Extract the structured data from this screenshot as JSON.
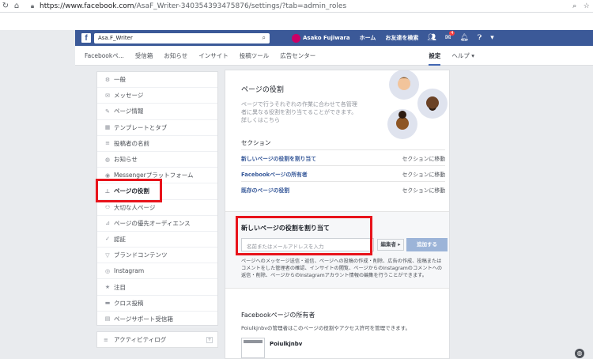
{
  "browser": {
    "url_host": "https://www.facebook.com",
    "url_path": "/AsaF_Writer-340354393475876/settings/?tab=admin_roles"
  },
  "fbbar": {
    "search_value": "Asa.F_Writer",
    "user_name": "Asako Fujiwara",
    "home": "ホーム",
    "find_friends": "お友達を検索",
    "notif_badge": "4"
  },
  "pagenav": {
    "tabs": [
      "Facebookペ...",
      "受信箱",
      "お知らせ",
      "インサイト",
      "投稿ツール",
      "広告センター"
    ],
    "settings": "設定",
    "help": "ヘルプ ▾"
  },
  "sidebar": {
    "items": [
      {
        "icon": "gear-icon",
        "glyph": "⚙",
        "label": "一般"
      },
      {
        "icon": "message-icon",
        "glyph": "✉",
        "label": "メッセージ"
      },
      {
        "icon": "pencil-icon",
        "glyph": "✎",
        "label": "ページ情報"
      },
      {
        "icon": "grid-icon",
        "glyph": "▦",
        "label": "テンプレートとタブ"
      },
      {
        "icon": "list-icon",
        "glyph": "≡",
        "label": "投稿者の名前"
      },
      {
        "icon": "globe-icon",
        "glyph": "◍",
        "label": "お知らせ"
      },
      {
        "icon": "messenger-icon",
        "glyph": "◉",
        "label": "Messengerプラットフォーム"
      },
      {
        "icon": "person-icon",
        "glyph": "⊥",
        "label": "ページの役割"
      },
      {
        "icon": "people-icon",
        "glyph": "⚇",
        "label": "大切な人ページ"
      },
      {
        "icon": "audience-icon",
        "glyph": "⊿",
        "label": "ページの優先オーディエンス"
      },
      {
        "icon": "wrench-icon",
        "glyph": "✓",
        "label": "認証"
      },
      {
        "icon": "branded-icon",
        "glyph": "▽",
        "label": "ブランドコンテンツ"
      },
      {
        "icon": "instagram-icon",
        "glyph": "◎",
        "label": "Instagram"
      },
      {
        "icon": "star-icon",
        "glyph": "★",
        "label": "注目"
      },
      {
        "icon": "video-icon",
        "glyph": "▬",
        "label": "クロス投稿"
      },
      {
        "icon": "inbox-icon",
        "glyph": "▤",
        "label": "ページサポート受信箱"
      }
    ],
    "activity": {
      "glyph": "≡",
      "label": "アクティビティログ",
      "plus": "+"
    }
  },
  "main": {
    "title": "ページの役割",
    "description": "ページで行うそれぞれの作業に合わせて各管理者に異なる役割を割り当てることができます。詳しくはこちら",
    "section_title": "セクション",
    "rows": [
      {
        "label": "新しいページの役割を割り当て",
        "action": "セクションに移動"
      },
      {
        "label": "Facebookページの所有者",
        "action": "セクションに移動"
      },
      {
        "label": "既存のページの役割",
        "action": "セクションに移動"
      }
    ],
    "assign": {
      "title": "新しいページの役割を割り当て",
      "placeholder": "名前またはメールアドレスを入力",
      "role_button": "編集者 ▸",
      "add_button": "追加する",
      "body": "ページへのメッセージ送信・返信、ページへの投稿の作成・削除、広告の作成、投稿またはコメントをした管理者の確認、インサイトの閲覧、ページからのInstagramのコメントへの返信・削除、ページからのInstagramアカウント情報の編集を行うことができます。"
    },
    "owners": {
      "title": "Facebookページの所有者",
      "description": "Poiulkjnbvの管理者はこのページの役割やアクセス許可を管理できます。",
      "name": "Poiulkjnbv"
    }
  }
}
